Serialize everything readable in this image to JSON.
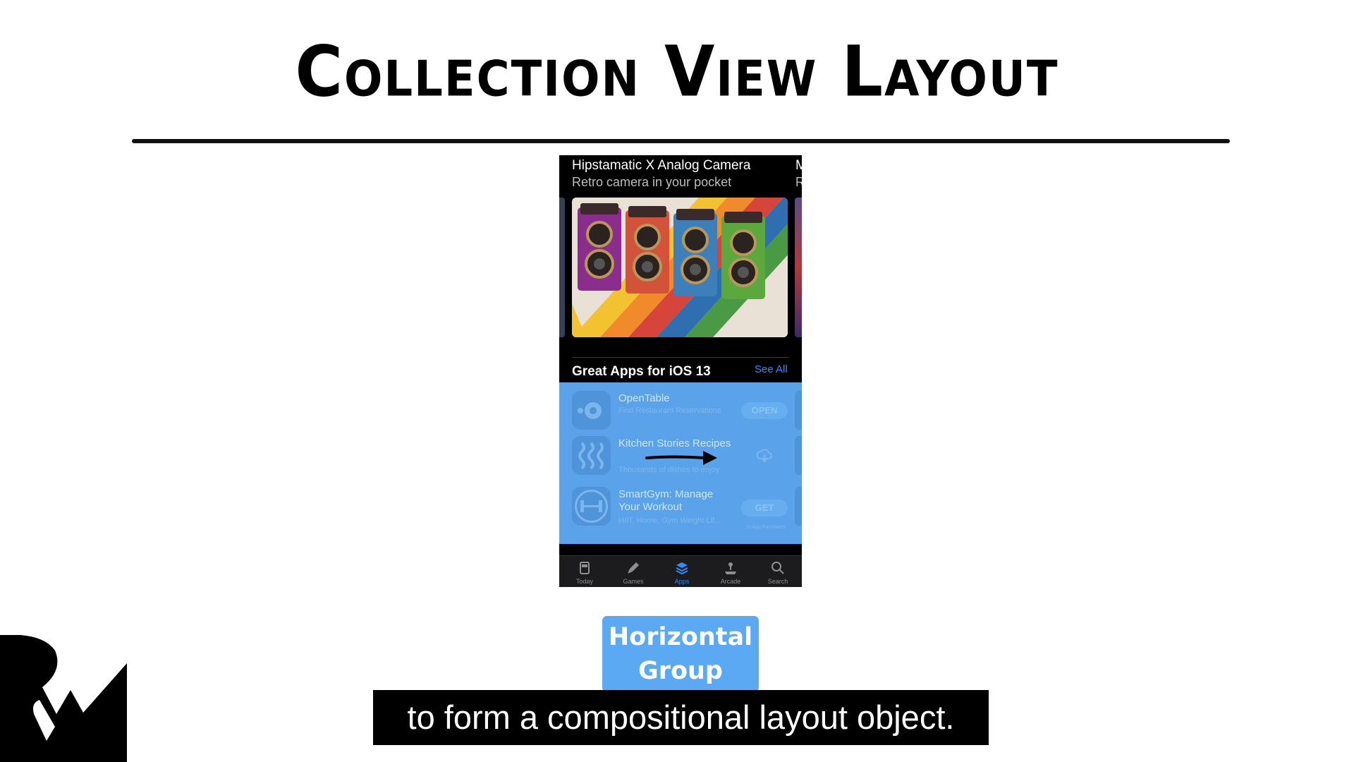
{
  "slide": {
    "title": "Collection View Layout",
    "badge_label": "Horizontal\nGroup",
    "caption": "to form a compositional layout object."
  },
  "phone": {
    "featured": {
      "title": "Hipstamatic X Analog Camera",
      "subtitle": "Retro camera in your pocket",
      "peek_title": "M",
      "peek_subtitle": "R"
    },
    "section": {
      "title": "Great Apps for iOS 13",
      "see_all": "See All"
    },
    "apps": [
      {
        "name": "OpenTable",
        "subtitle": "Find Restaurant Reservations",
        "action": "OPEN",
        "icon": "opentable-icon"
      },
      {
        "name": "Kitchen Stories Recipes",
        "subtitle": "Thousands of dishes to enjoy",
        "action": "",
        "icon": "kitchen-stories-icon"
      },
      {
        "name": "SmartGym: Manage Your Workout",
        "subtitle": "HIIT, Home, Gym Weight Lif...",
        "action": "GET",
        "action_note": "In-App Purchases",
        "icon": "dumbbell-icon"
      }
    ],
    "tabs": [
      {
        "label": "Today",
        "icon": "today-icon",
        "active": false
      },
      {
        "label": "Games",
        "icon": "rocket-icon",
        "active": false
      },
      {
        "label": "Apps",
        "icon": "apps-stack-icon",
        "active": true
      },
      {
        "label": "Arcade",
        "icon": "joystick-icon",
        "active": false
      },
      {
        "label": "Search",
        "icon": "search-icon",
        "active": false
      }
    ]
  },
  "colors": {
    "accent_blue": "#2f8cff",
    "overlay_blue": "#5aa3ea",
    "badge_blue": "#5aa9f2",
    "background": "#ffffff"
  }
}
